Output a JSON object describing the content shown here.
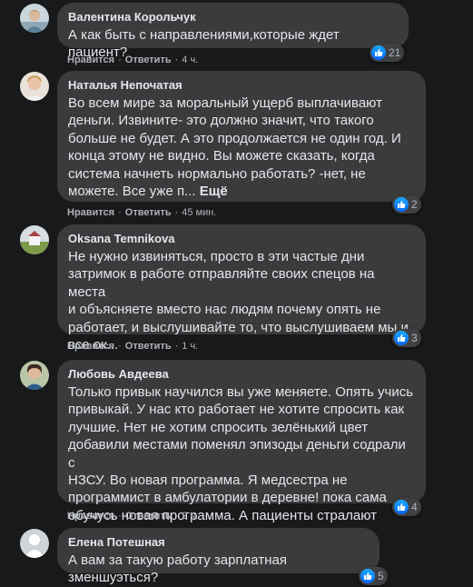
{
  "ui": {
    "like_label": "Нравится",
    "reply_label": "Ответить",
    "more_label": "Ещё",
    "separator": "·"
  },
  "comments": [
    {
      "author": "Валентина Корольчук",
      "text": "А как быть с направлениями,которые ждет пациент?",
      "time": "4 ч.",
      "reactions": "21"
    },
    {
      "author": "Наталья Непочатая",
      "text": "Во всем мире за моральный ущерб выплачивают\nденьги. Извините- это должно значит, что такого\nбольше не будет. А это продолжается не один год. И\nконца этому не видно. Вы можете сказать, когда\nсистема начнеть нормально работать? -нет, не\nможете. Все уже п... ",
      "time": "45 мин.",
      "reactions": "2"
    },
    {
      "author": "Oksana Temnikova",
      "text": "Не нужно извиняться, просто в эти частые дни\nзатримок в работе отправляйте своих спецов на места\nи объясняете вместо нас людям почему опять не\nработает, и выслушивайте то, что выслушиваем мы и\nвсе ок...",
      "time": "1 ч.",
      "reactions": "3"
    },
    {
      "author": "Любовь Авдеева",
      "text": "Только привык научился вы уже меняете. Опять учись\nпривыкай. У нас кто работает не хотите спросить как\nлучшие. Нет не хотим спросить зелёнький цвет\nдобавили местами поменял эпизоды деньги содрали с\nНЗСУ. Во новая программа. Я медсестра не\nпрограммист в амбулатории в деревне! пока сама\nобучусь новая программа. А пациенты стралают",
      "time": "2 ч.",
      "reactions": "4"
    },
    {
      "author": "Елена Потешная",
      "text": "А вам за такую работу зарплатная зменшуэться?",
      "time": "",
      "reactions": "5"
    }
  ],
  "colors": {
    "background": "#18191a",
    "bubble": "#3a3b3c",
    "primary_text": "#e4e6eb",
    "secondary_text": "#b0b3b8",
    "like_blue": "#0866ff"
  },
  "icons": {
    "reaction": "like-thumb-icon",
    "default_avatar": "default-avatar-icon"
  }
}
